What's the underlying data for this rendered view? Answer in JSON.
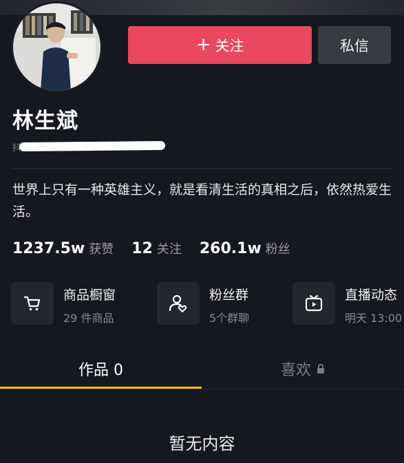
{
  "profile": {
    "name": "林生斌",
    "douyin_id_prefix": "抖音号：",
    "bio": "世界上只有一种英雄主义，就是看清生活的真相之后，依然热爱生活。"
  },
  "actions": {
    "follow_plus": "+",
    "follow_label": "关注",
    "message_label": "私信"
  },
  "stats": {
    "likes_value": "1237.5w",
    "likes_label": "获赞",
    "following_value": "12",
    "following_label": "关注",
    "fans_value": "260.1w",
    "fans_label": "粉丝"
  },
  "cards": [
    {
      "title": "商品橱窗",
      "sub": "29 件商品",
      "icon": "cart-icon"
    },
    {
      "title": "粉丝群",
      "sub": "5个群聊",
      "icon": "group-icon"
    },
    {
      "title": "直播动态",
      "sub": "明天 13:00",
      "icon": "tv-icon"
    }
  ],
  "tabs": {
    "works_label": "作品 0",
    "likes_label": "喜欢"
  },
  "empty_text": "暂无内容",
  "colors": {
    "background": "#16181f",
    "follow_button": "#ea4760",
    "message_button": "#393b42",
    "tab_indicator": "#f5c21b"
  }
}
